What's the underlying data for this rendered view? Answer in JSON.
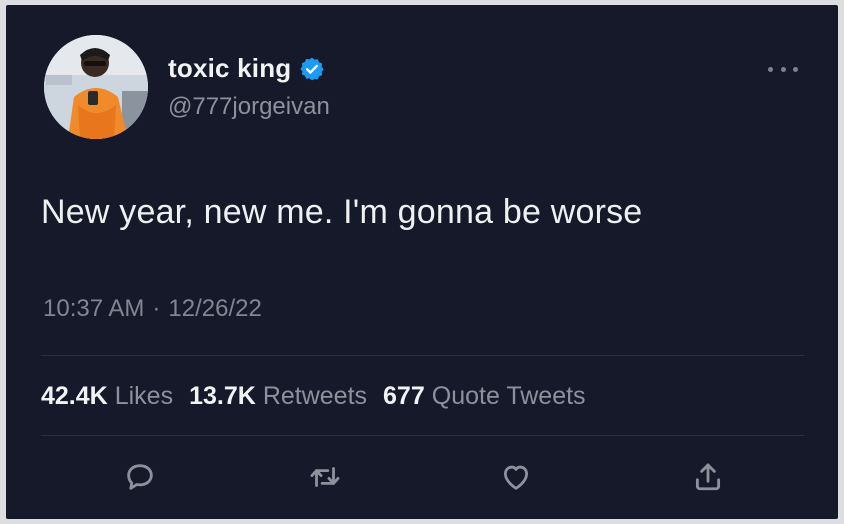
{
  "author": {
    "display_name": "toxic king",
    "handle": "@777jorgeivan",
    "verified": true,
    "verified_color": "#1d9bf0"
  },
  "tweet": {
    "text": "New year, new me. I'm gonna be worse",
    "time": "10:37 AM",
    "separator": "·",
    "date": "12/26/22"
  },
  "stats": {
    "likes_count": "42.4K",
    "likes_label": "Likes",
    "retweets_count": "13.7K",
    "retweets_label": "Retweets",
    "quotes_count": "677",
    "quotes_label": "Quote Tweets"
  },
  "actions": [
    {
      "icon": "reply-icon"
    },
    {
      "icon": "retweet-icon"
    },
    {
      "icon": "like-icon"
    },
    {
      "icon": "share-icon"
    }
  ],
  "colors": {
    "background": "#16192a",
    "text_primary": "#eef0f2",
    "text_secondary": "#8a929c",
    "divider": "#2c3140"
  }
}
